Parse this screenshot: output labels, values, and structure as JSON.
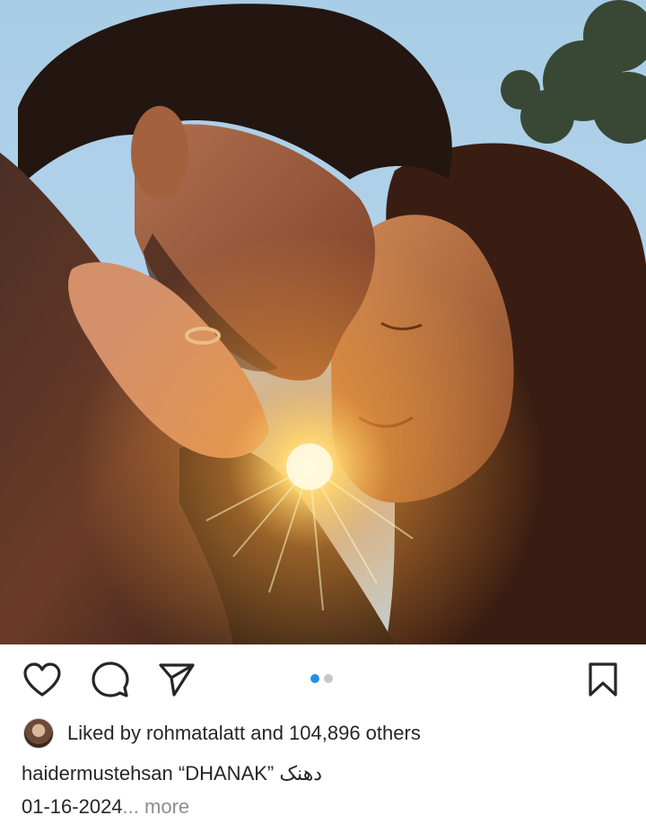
{
  "post": {
    "image_alt": "Couple touching foreheads at sunset",
    "carousel": {
      "count": 2,
      "active_index": 0
    }
  },
  "actions": {
    "like_icon": "heart-icon",
    "comment_icon": "comment-icon",
    "share_icon": "send-icon",
    "save_icon": "bookmark-icon"
  },
  "likes": {
    "text": "Liked by rohmatalatt and 104,896 others"
  },
  "caption": {
    "username": "haidermustehsan",
    "text": "“DHANAK” دھنک",
    "date": "01-16-2024",
    "ellipsis": "...",
    "more_label": "more"
  },
  "colors": {
    "accent_dot": "#1f8fe8",
    "inactive_dot": "#c8c8c8",
    "text": "#262626",
    "muted": "#8e8e8e"
  }
}
